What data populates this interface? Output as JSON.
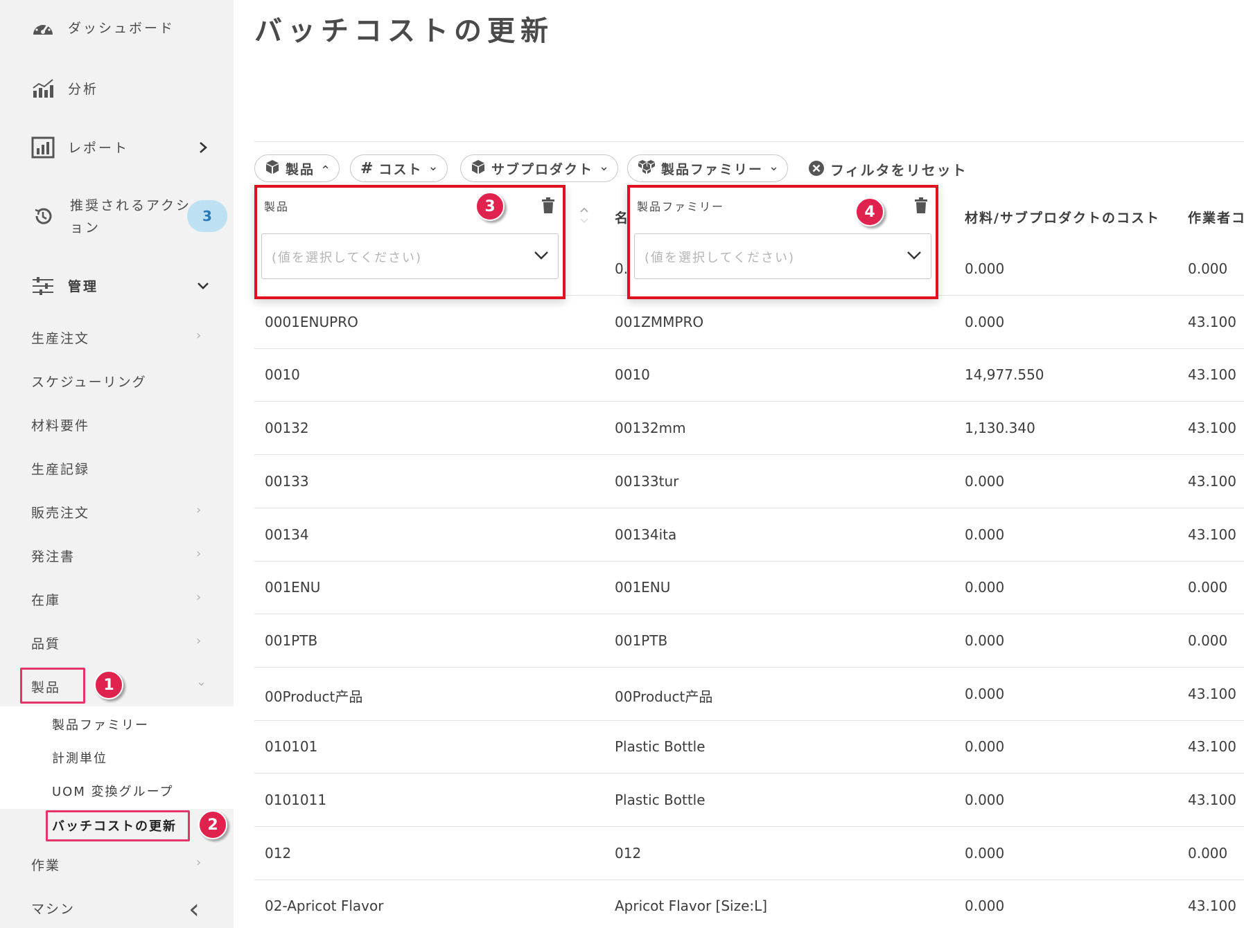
{
  "page": {
    "title": "バッチコストの更新"
  },
  "sidebar": {
    "items": [
      {
        "label": "ダッシュボード",
        "icon": "gauge-icon"
      },
      {
        "label": "分析",
        "icon": "analytics-chart-icon"
      },
      {
        "label": "レポート",
        "icon": "report-chart-icon"
      },
      {
        "label": "推奨されるアクシ",
        "label2": "ョン",
        "icon": "history-icon",
        "badge": "3"
      },
      {
        "label": "管理",
        "icon": "sliders-icon"
      }
    ],
    "sub_items": [
      {
        "label": "生産注文",
        "chevron": "›"
      },
      {
        "label": "スケジューリング"
      },
      {
        "label": "材料要件"
      },
      {
        "label": "生産記録"
      },
      {
        "label": "販売注文",
        "chevron": "›"
      },
      {
        "label": "発注書",
        "chevron": "›"
      },
      {
        "label": "在庫",
        "chevron": "›"
      },
      {
        "label": "品質",
        "chevron": "›"
      },
      {
        "label": "製品",
        "chevron": "⌄"
      }
    ],
    "product_submenu": [
      {
        "label": "製品ファミリー"
      },
      {
        "label": "計測単位"
      },
      {
        "label": "UOM 変換グループ"
      },
      {
        "label": "バッチコストの更新"
      }
    ],
    "after_items": [
      {
        "label": "作業",
        "chevron": "›"
      },
      {
        "label": "マシン"
      }
    ],
    "collapse_glyph": "‹"
  },
  "steps": [
    "1",
    "2",
    "3",
    "4"
  ],
  "filters": {
    "chips": [
      {
        "label": "製品",
        "icon": "cube-icon",
        "chevron": "⌃"
      },
      {
        "label": "コスト",
        "icon": "hash-icon",
        "chevron": "⌄"
      },
      {
        "label": "サブプロダクト",
        "icon": "cube-icon",
        "chevron": "⌄"
      },
      {
        "label": "製品ファミリー",
        "icon": "cubes-icon",
        "chevron": "⌄"
      }
    ],
    "reset_label": "フィルタをリセット"
  },
  "popups": [
    {
      "title": "製品",
      "placeholder": "(値を選択してください)"
    },
    {
      "title": "製品ファミリー",
      "placeholder": "(値を選択してください)"
    }
  ],
  "table": {
    "headers": [
      "名",
      "材料/サブプロダクトのコスト",
      "作業者コ"
    ],
    "partial_first_cell": "0.",
    "rows": [
      [
        "",
        "",
        "0.000",
        "0.000"
      ],
      [
        "0001ENUPRO",
        "001ZMMPRO",
        "0.000",
        "43.100"
      ],
      [
        "0010",
        "0010",
        "14,977.550",
        "43.100"
      ],
      [
        "00132",
        "00132mm",
        "1,130.340",
        "43.100"
      ],
      [
        "00133",
        "00133tur",
        "0.000",
        "43.100"
      ],
      [
        "00134",
        "00134ita",
        "0.000",
        "43.100"
      ],
      [
        "001ENU",
        "001ENU",
        "0.000",
        "0.000"
      ],
      [
        "001PTB",
        "001PTB",
        "0.000",
        "0.000"
      ],
      [
        "00Product产品",
        "00Product产品",
        "0.000",
        "43.100"
      ],
      [
        "010101",
        "Plastic Bottle",
        "0.000",
        "43.100"
      ],
      [
        "0101011",
        "Plastic Bottle",
        "0.000",
        "43.100"
      ],
      [
        "012",
        "012",
        "0.000",
        "0.000"
      ],
      [
        "02-Apricot Flavor",
        "Apricot Flavor [Size:L]",
        "0.000",
        "43.100"
      ]
    ]
  },
  "colors": {
    "highlight": "#e8336a",
    "popup_border": "#e0101e",
    "step_badge": "#e0234e",
    "badge_bg": "#bde0f2"
  }
}
